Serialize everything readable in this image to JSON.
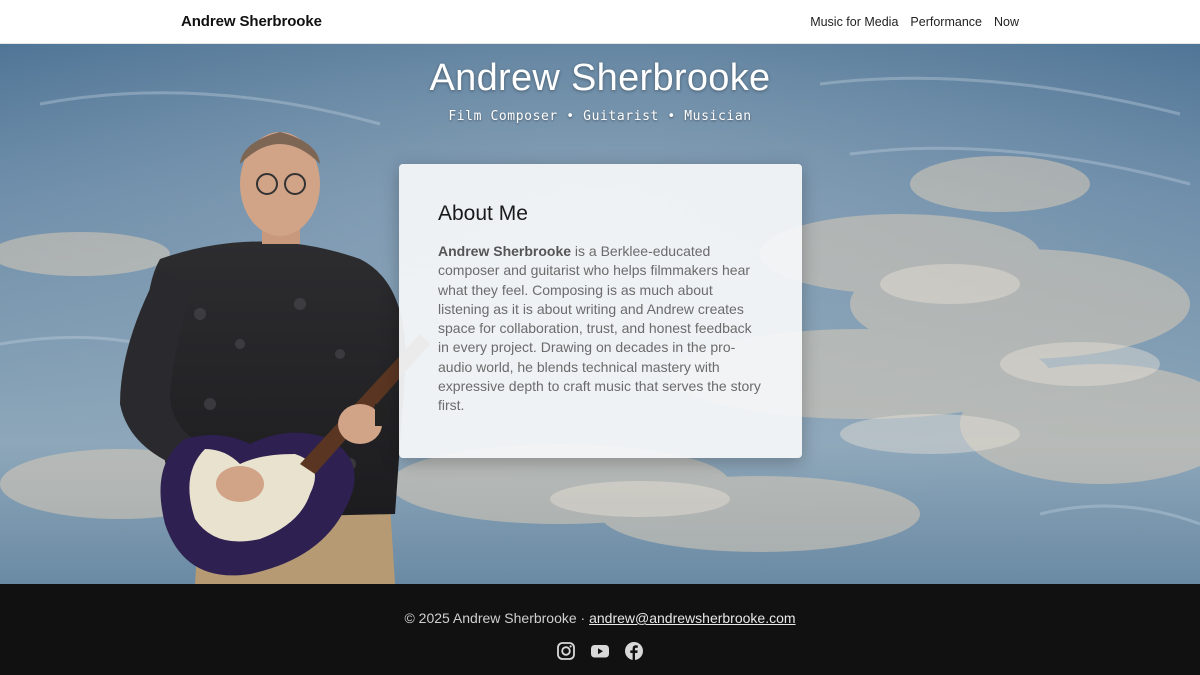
{
  "header": {
    "brand": "Andrew Sherbrooke",
    "nav": [
      {
        "label": "Music for Media"
      },
      {
        "label": "Performance"
      },
      {
        "label": "Now"
      }
    ]
  },
  "hero": {
    "title": "Andrew Sherbrooke",
    "subtitle": "Film Composer • Guitarist • Musician"
  },
  "about": {
    "heading": "About Me",
    "name": "Andrew Sherbrooke",
    "text": " is a Berklee-educated composer and guitarist who helps filmmakers hear what they feel. Composing is as much about listening as it is about writing and Andrew creates space for collaboration, trust, and honest feedback in every project. Drawing on decades in the pro-audio world, he blends technical mastery with expressive depth to craft music that serves the story first."
  },
  "footer": {
    "copyright": "© 2025 Andrew Sherbrooke · ",
    "email": "andrew@andrewsherbrooke.com",
    "socials": [
      "instagram-icon",
      "youtube-icon",
      "facebook-icon"
    ]
  },
  "colors": {
    "header_bg": "#ffffff",
    "footer_bg": "#111111",
    "card_bg": "#f4f6f8",
    "sky_blue": "#6b8ba8"
  }
}
